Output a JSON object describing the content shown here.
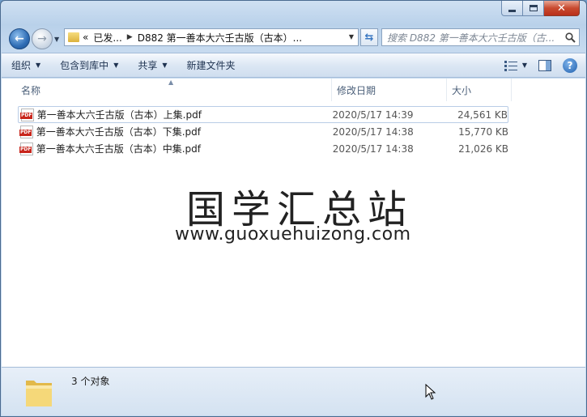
{
  "window": {
    "caption": {
      "minimize": "minimize",
      "maximize": "maximize",
      "close": "close"
    }
  },
  "address_bar": {
    "prefix": "«",
    "crumb1": "已发...",
    "crumb2": "D882 第一善本大六壬古版（古本）...",
    "search_placeholder": "搜索 D882 第一善本大六壬古版（古..."
  },
  "toolbar": {
    "organize": "组织",
    "include_in_library": "包含到库中",
    "share": "共享",
    "new_folder": "新建文件夹"
  },
  "columns": {
    "name": "名称",
    "date": "修改日期",
    "size": "大小"
  },
  "files": [
    {
      "name": "第一善本大六壬古版（古本）上集.pdf",
      "date": "2020/5/17 14:39",
      "size": "24,561 KB"
    },
    {
      "name": "第一善本大六壬古版（古本）下集.pdf",
      "date": "2020/5/17 14:38",
      "size": "15,770 KB"
    },
    {
      "name": "第一善本大六壬古版（古本）中集.pdf",
      "date": "2020/5/17 14:38",
      "size": "21,026 KB"
    }
  ],
  "watermark": {
    "title": "国学汇总站",
    "url": "www.guoxuehuizong.com"
  },
  "status": {
    "count": "3 个对象"
  },
  "icons": {
    "back": "back-arrow-icon",
    "forward": "forward-arrow-icon",
    "refresh": "refresh-icon",
    "search": "search-icon",
    "help": "help-icon",
    "file": "pdf-file-icon"
  },
  "colors": {
    "accent": "#2f6db5",
    "close": "#c84a2f",
    "pdf_red": "#c8261c"
  }
}
